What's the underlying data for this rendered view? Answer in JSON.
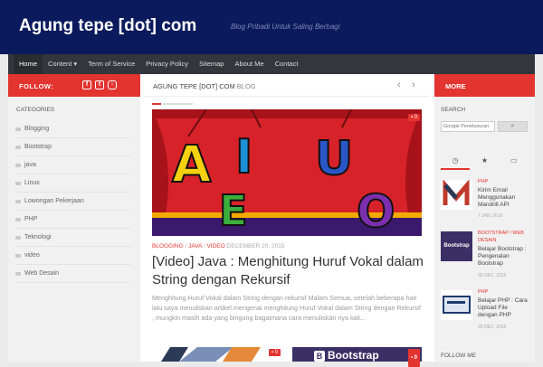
{
  "header": {
    "title": "Agung tepe [dot] com",
    "tagline": "Blog Pribadi Untuk Saling Berbagi"
  },
  "nav": {
    "items": [
      "Home",
      "Content",
      "Term of Service",
      "Privacy Policy",
      "Sitemap",
      "About Me",
      "Contact"
    ],
    "active": "Home"
  },
  "left_sidebar": {
    "follow_label": "FOLLOW:",
    "social_icons": [
      "facebook-icon",
      "twitter-icon",
      "instagram-icon"
    ],
    "categories_title": "CATEGORIES",
    "categories": [
      "Blogging",
      "Bootstrap",
      "java",
      "Linux",
      "Lowongan Pekerjaan",
      "PHP",
      "Teknologi",
      "video",
      "Web Desain"
    ]
  },
  "main": {
    "breadcrumb_site": "AGUNG TEPE [DOT] COM",
    "breadcrumb_section": "BLOG",
    "featured": {
      "comments": "0",
      "categories": [
        "BLOGGING",
        "JAVA",
        "VIDEO"
      ],
      "date": "DECEMBER 20, 2015",
      "title": "[Video] Java : Menghitung Huruf Vokal dalam String dengan Rekursif",
      "excerpt": "Menghitung Huruf Vokal dalam String dengan rekursif Malam Semua, setelah beberapa hari lalu saya menuliskan artikel mengenai menghitung Huruf Vokal dalam String dengan Rekursif , mungkin masih ada yang bingung bagaimana cara menuliskan nya kali...",
      "image_letters": [
        "A",
        "I",
        "U",
        "E",
        "O"
      ]
    },
    "thumb2_text": "Bootstrap",
    "thumb_comments": [
      "0",
      "0"
    ]
  },
  "right_sidebar": {
    "more_label": "MORE",
    "search_title": "SEARCH",
    "search_placeholder": "Google Penelusuran",
    "tabs": [
      "clock-icon",
      "star-icon",
      "comment-icon"
    ],
    "posts": [
      {
        "category": "PHP",
        "title": "Kirim Email Menggunakan Mandrill API",
        "date": "7 JAN, 2016"
      },
      {
        "category": "BOOTSTRAP / WEB DESAIN",
        "title": "Belajar Bootstrap : Pengenalan Bootstrap",
        "date": "30 DEC, 2015"
      },
      {
        "category": "PHP",
        "title": "Belajar PHP : Cara Upload File dengan PHP",
        "date": "28 DEC, 2015"
      }
    ],
    "follow_me": "FOLLOW ME"
  },
  "colors": {
    "accent": "#e3342f",
    "header": "#0a1a5c",
    "nav": "#33363b"
  }
}
